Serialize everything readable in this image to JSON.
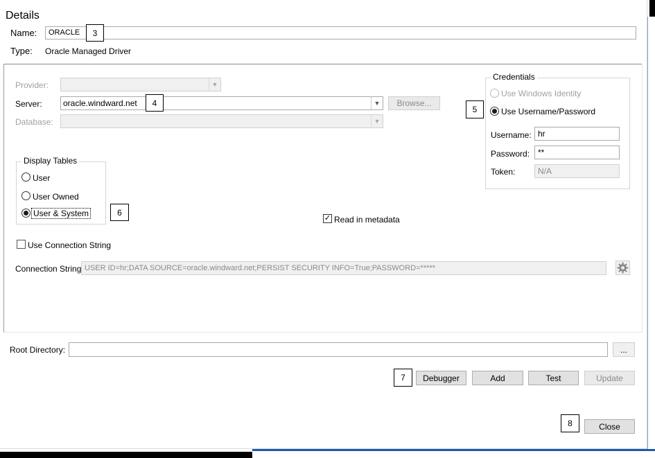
{
  "details": {
    "title": "Details",
    "name_label": "Name:",
    "name_value": "ORACLE",
    "type_label": "Type:",
    "type_value": "Oracle Managed Driver"
  },
  "connection": {
    "provider_label": "Provider:",
    "provider_value": "",
    "server_label": "Server:",
    "server_value": "oracle.windward.net",
    "browse_label": "Browse...",
    "database_label": "Database:",
    "database_value": ""
  },
  "credentials": {
    "title": "Credentials",
    "windows_identity_label": "Use Windows Identity",
    "username_password_label": "Use Username/Password",
    "selected": "Use Username/Password",
    "username_label": "Username:",
    "username_value": "hr",
    "password_label": "Password:",
    "password_value": "**",
    "token_label": "Token:",
    "token_value": "N/A"
  },
  "display_tables": {
    "title": "Display Tables",
    "options": [
      "User",
      "User Owned",
      "User & System"
    ],
    "selected": "User & System"
  },
  "read_in_metadata": {
    "label": "Read in metadata",
    "checked": true
  },
  "use_connection_string": {
    "label": "Use Connection String",
    "checked": false
  },
  "connection_string": {
    "label": "Connection String:",
    "value": "USER ID=hr;DATA SOURCE=oracle.windward.net;PERSIST SECURITY INFO=True;PASSWORD=*****"
  },
  "root_directory": {
    "label": "Root Directory:",
    "value": "",
    "browse_label": "..."
  },
  "buttons": {
    "debugger": "Debugger",
    "add": "Add",
    "test": "Test",
    "update": "Update",
    "close": "Close"
  },
  "markers": {
    "m3": "3",
    "m4": "4",
    "m5": "5",
    "m6": "6",
    "m7": "7",
    "m8": "8"
  },
  "icons": {
    "settings": "gear-icon",
    "dropdown": "chevron-down-icon",
    "check": "check-icon"
  },
  "colors": {
    "window_bg": "#ffffff",
    "button_bg": "#e1e1e1",
    "disabled_bg": "#f0f0f0",
    "accent_blue": "#1e5aa8"
  }
}
